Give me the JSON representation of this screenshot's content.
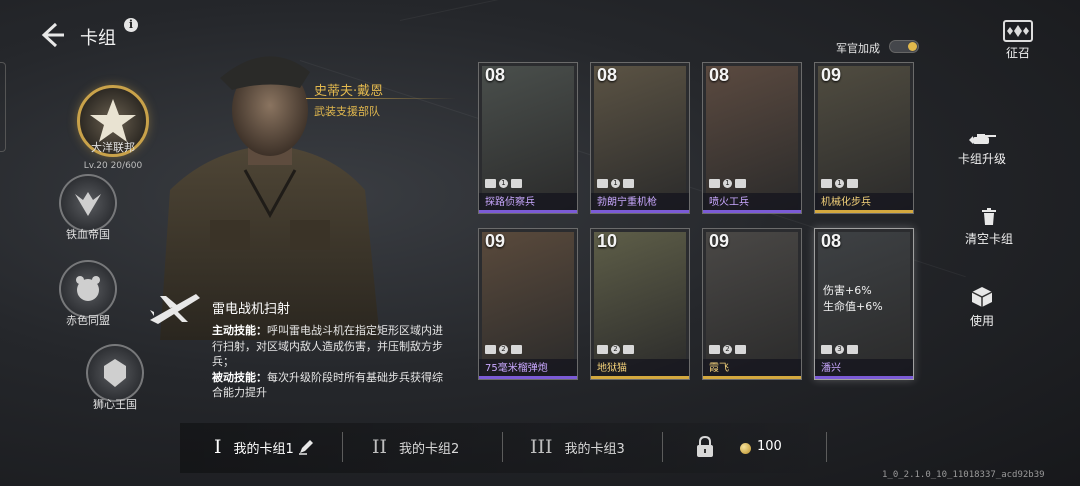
{
  "header": {
    "title": "卡组",
    "info_glyph": "i"
  },
  "factions": [
    {
      "name": "大洋联邦",
      "level": "Lv.20",
      "progress": "20/600",
      "active": true,
      "icon": "star-emblem-icon"
    },
    {
      "name": "铁血帝国",
      "icon": "eagle-emblem-icon"
    },
    {
      "name": "赤色同盟",
      "icon": "bear-emblem-icon"
    },
    {
      "name": "狮心王国",
      "icon": "lion-emblem-icon"
    }
  ],
  "commander": {
    "name": "史蒂夫·戴恩",
    "unit": "武装支援部队"
  },
  "skill": {
    "title": "雷电战机扫射",
    "active_label": "主动技能：",
    "active_text": "呼叫雷电战斗机在指定矩形区域内进行扫射，对区域内敌人造成伤害，并压制敌方步兵；",
    "passive_label": "被动技能：",
    "passive_text": "每次升级阶段时所有基础步兵获得综合能力提升"
  },
  "officer_bonus": {
    "label": "军官加成",
    "enabled": true
  },
  "recruit": {
    "label": "征召",
    "glyph": "♠"
  },
  "cards": [
    {
      "cost": "08",
      "name": "探路侦察兵",
      "badge": "1",
      "bar": "#7b5bd6",
      "name_color": "#c9a8ff",
      "art": "#4a4f4c"
    },
    {
      "cost": "08",
      "name": "勃朗宁重机枪",
      "badge": "1",
      "bar": "#7b5bd6",
      "name_color": "#c9a8ff",
      "art": "#5b5344"
    },
    {
      "cost": "08",
      "name": "喷火工兵",
      "badge": "1",
      "bar": "#7b5bd6",
      "name_color": "#c9a8ff",
      "art": "#5b4a40"
    },
    {
      "cost": "09",
      "name": "机械化步兵",
      "badge": "1",
      "bar": "#d4a93f",
      "name_color": "#f4d27a",
      "art": "#504c40"
    },
    {
      "cost": "09",
      "name": "75毫米榴弹炮",
      "badge": "2",
      "bar": "#7b5bd6",
      "name_color": "#c9a8ff",
      "art": "#5a4a3c"
    },
    {
      "cost": "10",
      "name": "地狱猫",
      "badge": "2",
      "bar": "#d4a93f",
      "name_color": "#f4d27a",
      "art": "#5e5e48"
    },
    {
      "cost": "09",
      "name": "霞飞",
      "badge": "2",
      "bar": "#d4a93f",
      "name_color": "#f4d27a",
      "art": "#4a4846"
    },
    {
      "cost": "08",
      "name": "潘兴",
      "badge": "3",
      "bar": "#7b5bd6",
      "name_color": "#c9a8ff",
      "art": "#3e4144",
      "stats": [
        "伤害+6%",
        "生命值+6%"
      ]
    }
  ],
  "actions": [
    {
      "label": "卡组升级",
      "icon": "tank-upgrade-icon",
      "glyph": "▲"
    },
    {
      "label": "清空卡组",
      "icon": "trash-icon",
      "glyph": "🗑"
    },
    {
      "label": "使用",
      "icon": "use-box-icon",
      "glyph": "⬢"
    }
  ],
  "decks": [
    {
      "num": "I",
      "label": "我的卡组1",
      "active": true
    },
    {
      "num": "II",
      "label": "我的卡组2"
    },
    {
      "num": "III",
      "label": "我的卡组3"
    }
  ],
  "currency": {
    "value": "100"
  },
  "version": "1_0_2.1.0_10_11018337_acd92b39"
}
